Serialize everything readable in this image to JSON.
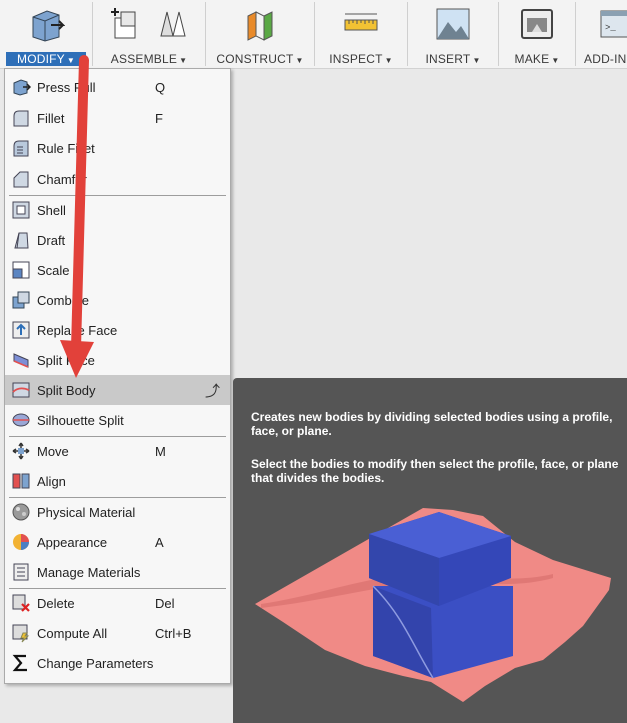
{
  "toolbar": {
    "groups": [
      {
        "label": "MODIFY"
      },
      {
        "label": "ASSEMBLE"
      },
      {
        "label": "CONSTRUCT"
      },
      {
        "label": "INSPECT"
      },
      {
        "label": "INSERT"
      },
      {
        "label": "MAKE"
      },
      {
        "label": "ADD-IN"
      }
    ],
    "dropdown_glyph": "▼"
  },
  "menu": {
    "items": [
      {
        "label": "Press Pull",
        "shortcut": "Q",
        "icon": "press-pull-icon"
      },
      {
        "label": "Fillet",
        "shortcut": "F",
        "icon": "fillet-icon"
      },
      {
        "label": "Rule Fillet",
        "shortcut": "",
        "icon": "rule-fillet-icon"
      },
      {
        "label": "Chamfer",
        "shortcut": "",
        "icon": "chamfer-icon"
      },
      {
        "label": "Shell",
        "shortcut": "",
        "icon": "shell-icon"
      },
      {
        "label": "Draft",
        "shortcut": "",
        "icon": "draft-icon"
      },
      {
        "label": "Scale",
        "shortcut": "",
        "icon": "scale-icon"
      },
      {
        "label": "Combine",
        "shortcut": "",
        "icon": "combine-icon"
      },
      {
        "label": "Replace Face",
        "shortcut": "",
        "icon": "replace-face-icon"
      },
      {
        "label": "Split Face",
        "shortcut": "",
        "icon": "split-face-icon"
      },
      {
        "label": "Split Body",
        "shortcut": "",
        "icon": "split-body-icon",
        "highlighted": true
      },
      {
        "label": "Silhouette Split",
        "shortcut": "",
        "icon": "silhouette-split-icon"
      },
      {
        "label": "Move",
        "shortcut": "M",
        "icon": "move-icon"
      },
      {
        "label": "Align",
        "shortcut": "",
        "icon": "align-icon"
      },
      {
        "label": "Physical Material",
        "shortcut": "",
        "icon": "physical-material-icon"
      },
      {
        "label": "Appearance",
        "shortcut": "A",
        "icon": "appearance-icon"
      },
      {
        "label": "Manage Materials",
        "shortcut": "",
        "icon": "manage-materials-icon"
      },
      {
        "label": "Delete",
        "shortcut": "Del",
        "icon": "delete-icon"
      },
      {
        "label": "Compute All",
        "shortcut": "Ctrl+B",
        "icon": "compute-all-icon"
      },
      {
        "label": "Change Parameters",
        "shortcut": "",
        "icon": "change-parameters-icon"
      }
    ],
    "repeat_glyph": "⤴"
  },
  "tooltip": {
    "description": "Creates new bodies by dividing selected bodies using a profile, face, or plane.",
    "instruction": "Select the bodies to modify then select the profile, face, or plane that divides the bodies."
  },
  "colors": {
    "accent": "#2e6fb8",
    "annotation_arrow": "#e2413a",
    "tooltip_bg": "#555555",
    "split_plane": "#f08a86",
    "body_blue": "#3b4fc4"
  }
}
